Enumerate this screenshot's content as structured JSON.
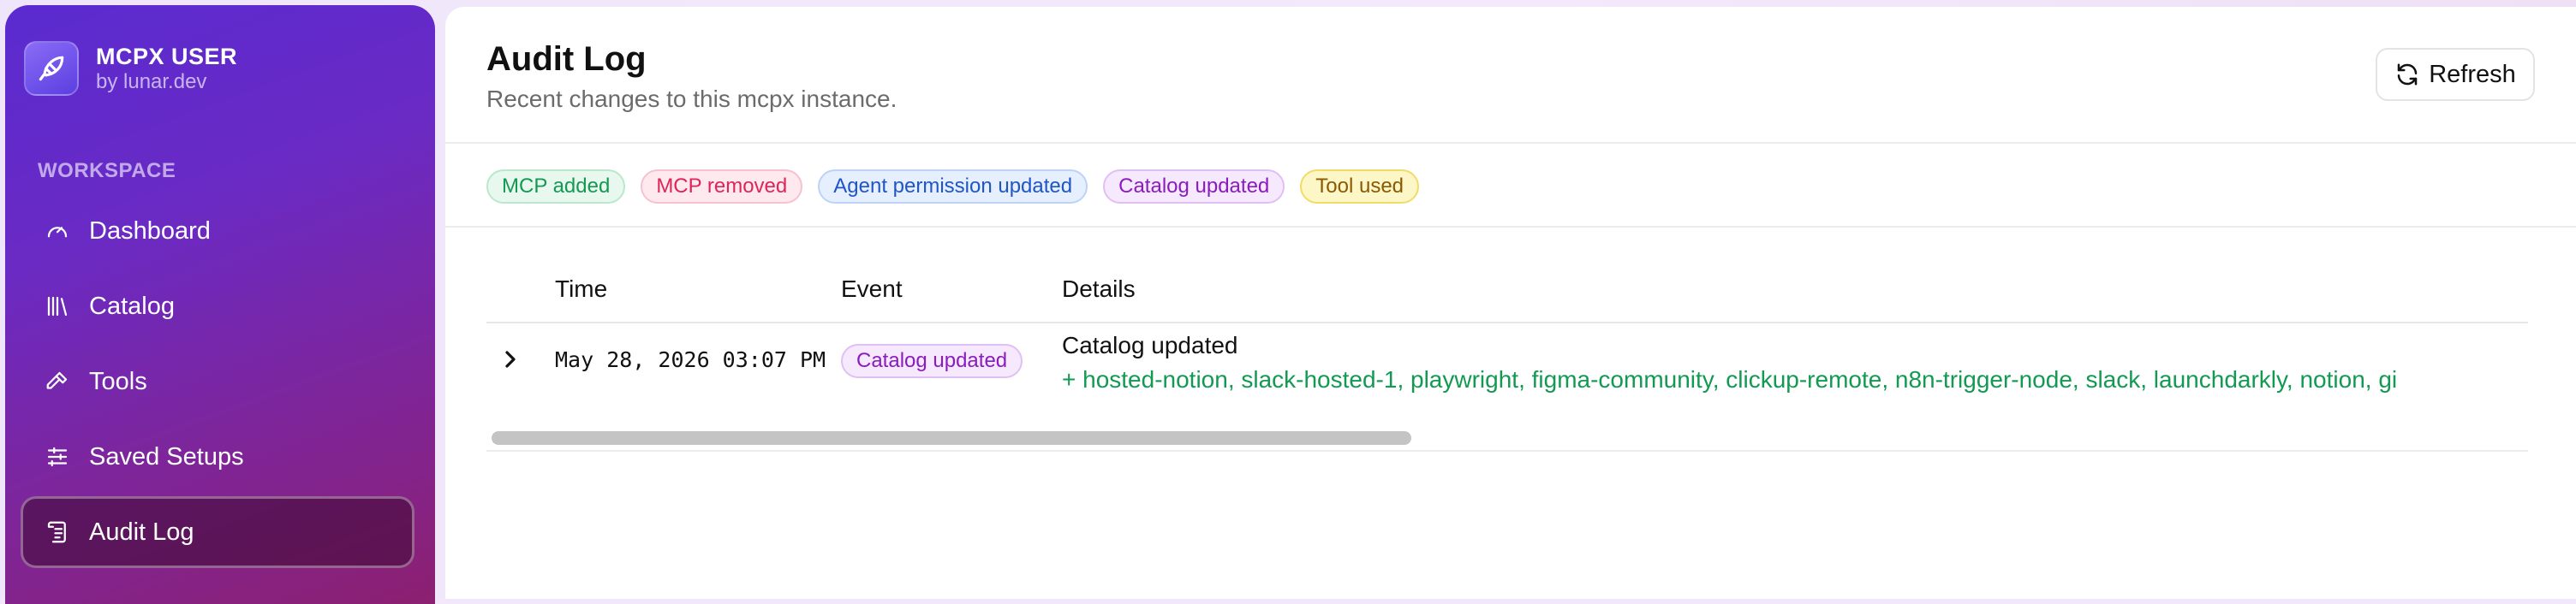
{
  "brand": {
    "title": "MCPX USER",
    "subtitle": "by lunar.dev",
    "logo_icon": "feather-logo-icon"
  },
  "sidebar": {
    "section_label": "WORKSPACE",
    "items": [
      {
        "label": "Dashboard",
        "icon": "gauge-icon",
        "active": false
      },
      {
        "label": "Catalog",
        "icon": "library-icon",
        "active": false
      },
      {
        "label": "Tools",
        "icon": "hammer-icon",
        "active": false
      },
      {
        "label": "Saved Setups",
        "icon": "sliders-icon",
        "active": false
      },
      {
        "label": "Audit Log",
        "icon": "scroll-icon",
        "active": true
      }
    ]
  },
  "header": {
    "title": "Audit Log",
    "subtitle": "Recent changes to this mcpx instance.",
    "refresh_label": "Refresh"
  },
  "filters": [
    {
      "label": "MCP added",
      "color": "#139a52"
    },
    {
      "label": "MCP removed",
      "color": "#dd2559"
    },
    {
      "label": "Agent permission updated",
      "color": "#1f55c7"
    },
    {
      "label": "Catalog updated",
      "color": "#8a1cbf"
    },
    {
      "label": "Tool used",
      "color": "#8a5a00"
    }
  ],
  "table": {
    "columns": [
      "Time",
      "Event",
      "Details"
    ],
    "rows": [
      {
        "time": "May 28, 2026 03:07 PM",
        "event": "Catalog updated",
        "details_title": "Catalog updated",
        "details_added": "+ hosted-notion, slack-hosted-1, playwright, figma-community, clickup-remote, n8n-trigger-node, slack, launchdarkly, notion, gi"
      }
    ]
  },
  "colors": {
    "accent": "#6a2ac4",
    "added": "#139a52"
  }
}
